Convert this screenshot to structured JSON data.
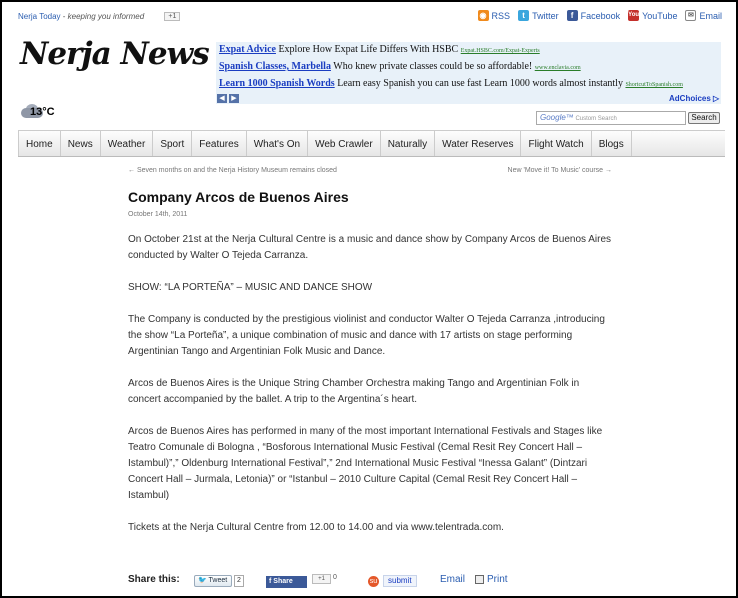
{
  "top": {
    "site_name": "Nerja Today",
    "separator": " - ",
    "tagline": "keeping you informed",
    "gplus_label": "+1"
  },
  "social": [
    {
      "label": "RSS",
      "icon": "rss-icon",
      "glyph": "◉"
    },
    {
      "label": "Twitter",
      "icon": "twitter-icon",
      "glyph": "t"
    },
    {
      "label": "Facebook",
      "icon": "facebook-icon",
      "glyph": "f"
    },
    {
      "label": "YouTube",
      "icon": "youtube-icon",
      "glyph": "You"
    },
    {
      "label": "Email",
      "icon": "email-icon",
      "glyph": "✉"
    }
  ],
  "logo": "Nerja News",
  "ads": [
    {
      "title": "Expat Advice",
      "desc": "Explore How Expat Life Differs With HSBC",
      "url": "Expat.HSBC.com/Expat-Experts"
    },
    {
      "title": "Spanish Classes, Marbella",
      "desc": "Who knew private classes could be so affordable!",
      "url": "www.enclavia.com"
    },
    {
      "title": "Learn 1000 Spanish Words",
      "desc": "Learn easy Spanish you can use fast Learn 1000 words almost instantly",
      "url": "ShortcutToSpanish.com"
    }
  ],
  "ad_choices": "AdChoices ▷",
  "weather": {
    "temp": "13°C"
  },
  "search": {
    "placeholder_brand": "Google™",
    "placeholder": "Custom Search",
    "button": "Search"
  },
  "nav": [
    "Home",
    "News",
    "Weather",
    "Sport",
    "Features",
    "What's On",
    "Web Crawler",
    "Naturally",
    "Water Reserves",
    "Flight Watch",
    "Blogs"
  ],
  "post_nav": {
    "prev": "← Seven months on and the Nerja History Museum remains closed",
    "next": "New 'Move it! To Music' course →"
  },
  "article": {
    "title": "Company Arcos de Buenos Aires",
    "date": "October 14th, 2011",
    "paragraphs": [
      "On October 21st at the Nerja Cultural Centre is a music and dance show by Company Arcos de Buenos Aires\nconducted by Walter O Tejeda Carranza.",
      "SHOW: “LA PORTEÑA” – MUSIC AND DANCE SHOW",
      "The Company is conducted by the prestigious violinist and conductor Walter O Tejeda Carranza ,introducing the show “La Porteña”, a unique combination of music and dance with 17 artists on stage performing Argentinian Tango and Argentinian Folk Music and Dance.",
      "Arcos de Buenos Aires is the Unique String Chamber Orchestra making Tango and Argentinian Folk in concert accompanied by the ballet. A trip to the Argentina´s heart.",
      "Arcos de Buenos Aires has performed in many of the most important International Festivals and Stages like Teatro Comunale di Bologna , “Bosforous International Music Festival (Cemal Resit Rey Concert Hall – Istambul)”,” Oldenburg International Festival”,” 2nd International Music Festival “Inessa Galant” (Dintzari Concert Hall – Jurmala, Letonia)” or “Istanbul – 2010 Culture Capital (Cemal Resit Rey Concert Hall – Istambul)",
      "Tickets at the Nerja Cultural Centre from 12.00 to 14.00 and via www.telentrada.com."
    ]
  },
  "share": {
    "label": "Share this:",
    "tweet": "Tweet",
    "tweet_count": "2",
    "fb_share": "Share",
    "gplus": "+1",
    "gplus_count": "0",
    "submit": "submit",
    "email": "Email",
    "print": "Print"
  }
}
